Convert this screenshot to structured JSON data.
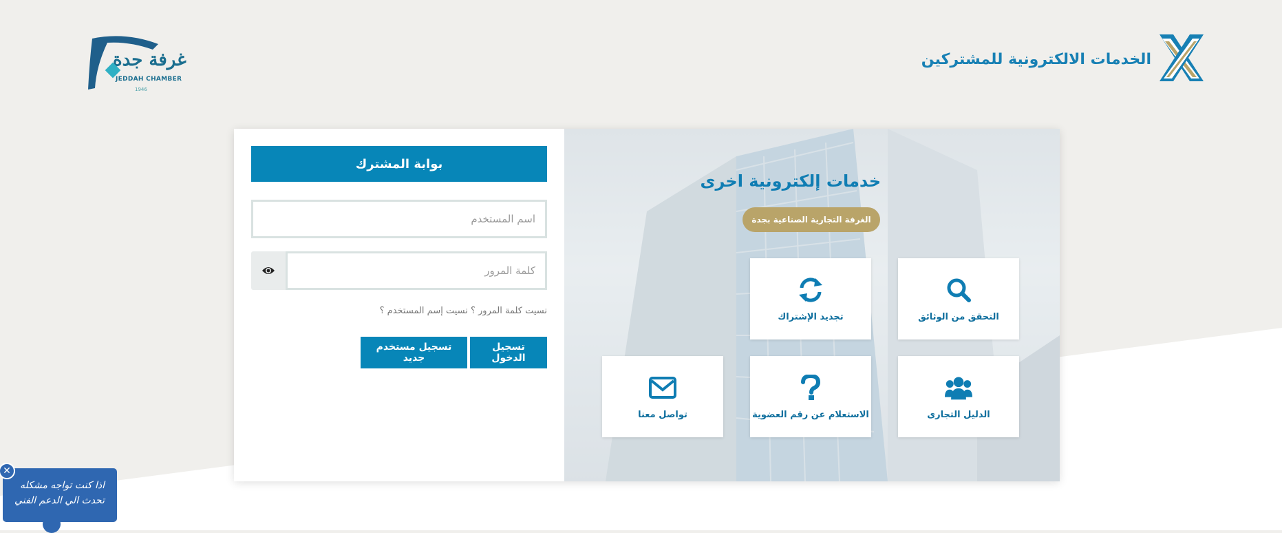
{
  "header": {
    "brand_title": "الخدمات الالكترونية للمشتركين",
    "chamber_name_ar": "غرفة جدة",
    "chamber_name_en": "JEDDAH CHAMBER",
    "chamber_year": "1946"
  },
  "login": {
    "portal_title": "بوابة المشترك",
    "username_placeholder": "اسم المستخدم",
    "password_placeholder": "كلمة المرور",
    "forgot_text": "نسيت كلمة المرور ؟ نسيت إسم المستخدم ؟",
    "login_button": "تسجيل الدخول",
    "register_button": "تسجيل مستخدم جديد"
  },
  "services": {
    "title": "خدمات إلكترونية اخرى",
    "chamber_pill": "الغرفة التجارية الصناعية بجدة",
    "tiles": [
      {
        "label": "التحقق من الوثائق",
        "icon": "search-icon"
      },
      {
        "label": "تجديد الإشتراك",
        "icon": "refresh-icon"
      },
      {
        "label": "الدليل التجارى",
        "icon": "users-icon"
      },
      {
        "label": "الاستعلام عن رقم العضوية",
        "icon": "question-icon"
      },
      {
        "label": "تواصل معنا",
        "icon": "envelope-icon"
      }
    ],
    "watermark_ar": "غرفة جدة",
    "watermark_en": "Jeddah Chamber"
  },
  "support": {
    "line1": "اذا كنت تواجه مشكله",
    "line2": "تحدث الي الدعم الفني",
    "close": "✕"
  },
  "colors": {
    "primary": "#0786b8",
    "gold": "#b9a469",
    "background": "#f0efec",
    "support": "#2f67b1"
  }
}
